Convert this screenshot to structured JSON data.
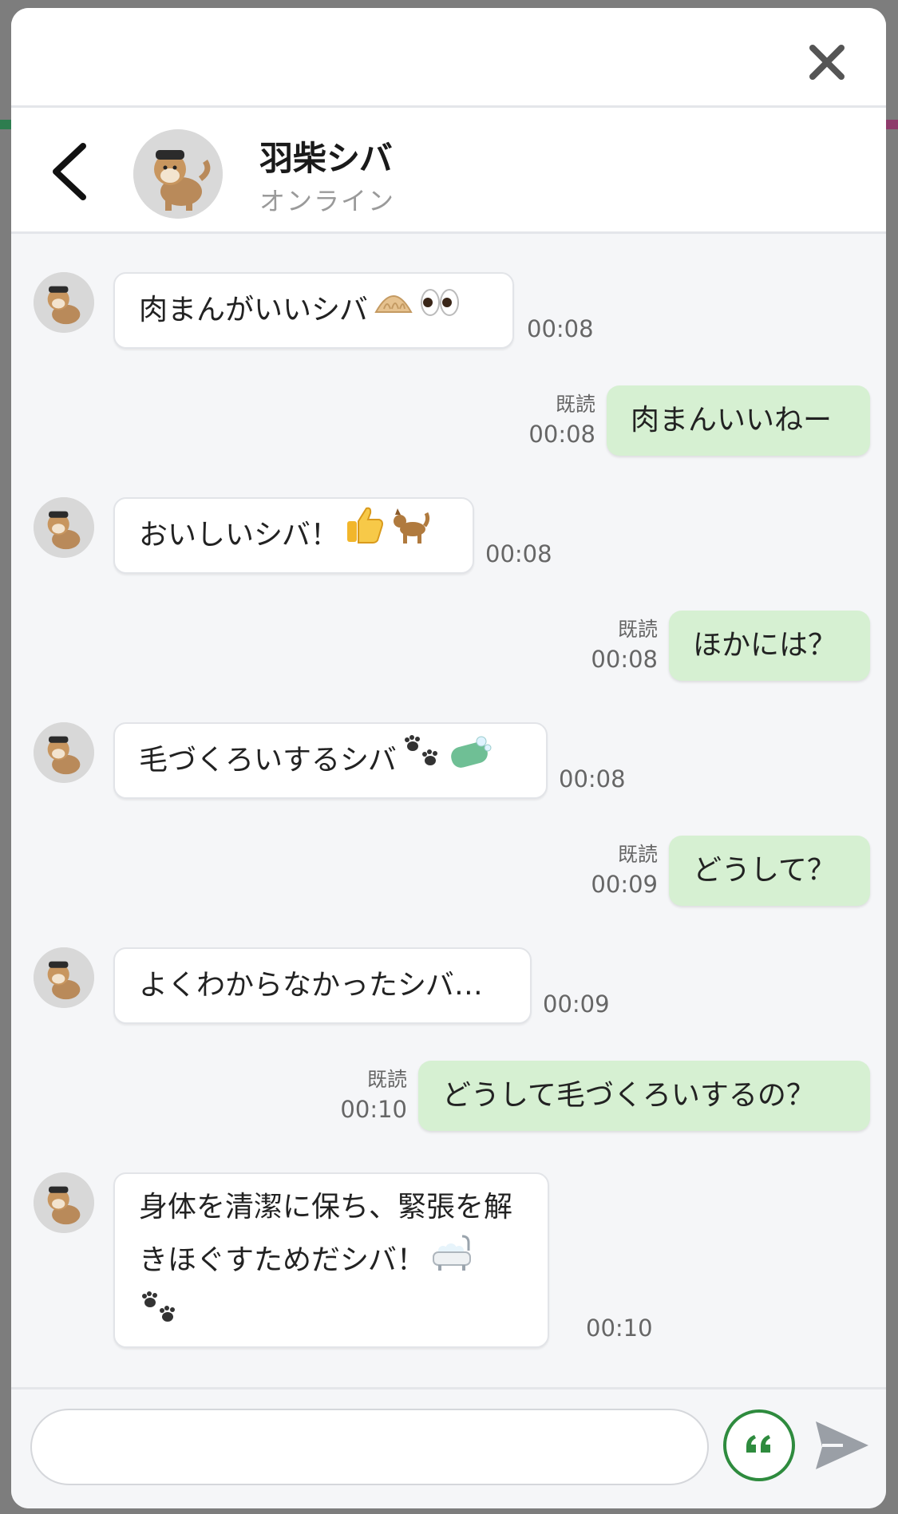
{
  "header": {
    "name": "羽柴シバ",
    "status": "オンライン"
  },
  "messages": [
    {
      "side": "in",
      "text": "肉まんがいいシバ",
      "emoji": [
        "dumpling",
        "eyes"
      ],
      "time": "00:08"
    },
    {
      "side": "out",
      "text": "肉まんいいねー",
      "read": "既読",
      "time": "00:08"
    },
    {
      "side": "in",
      "text": "おいしいシバ！",
      "emoji": [
        "thumbs-up",
        "dog"
      ],
      "time": "00:08"
    },
    {
      "side": "out",
      "text": "ほかには？",
      "read": "既読",
      "time": "00:08"
    },
    {
      "side": "in",
      "text": "毛づくろいするシバ",
      "emoji": [
        "paw-prints",
        "soap"
      ],
      "time": "00:08"
    },
    {
      "side": "out",
      "text": "どうして？",
      "read": "既読",
      "time": "00:09"
    },
    {
      "side": "in",
      "text": "よくわからなかったシバ…",
      "time": "00:09"
    },
    {
      "side": "out",
      "text": "どうして毛づくろいするの？",
      "read": "既読",
      "time": "00:10"
    },
    {
      "side": "in",
      "line1": "身体を清潔に保ち、緊張を解",
      "line2": "きほぐすためだシバ！",
      "emoji": [
        "bathtub",
        "paw-prints"
      ],
      "time": "00:10"
    }
  ],
  "composer": {
    "placeholder": "",
    "quote_icon": "quote-icon",
    "send_icon": "send-icon"
  },
  "colors": {
    "incoming_bubble": "#ffffff",
    "outgoing_bubble": "#d6f0d2",
    "accent": "#2e8b3e",
    "background": "#f5f6f8"
  }
}
